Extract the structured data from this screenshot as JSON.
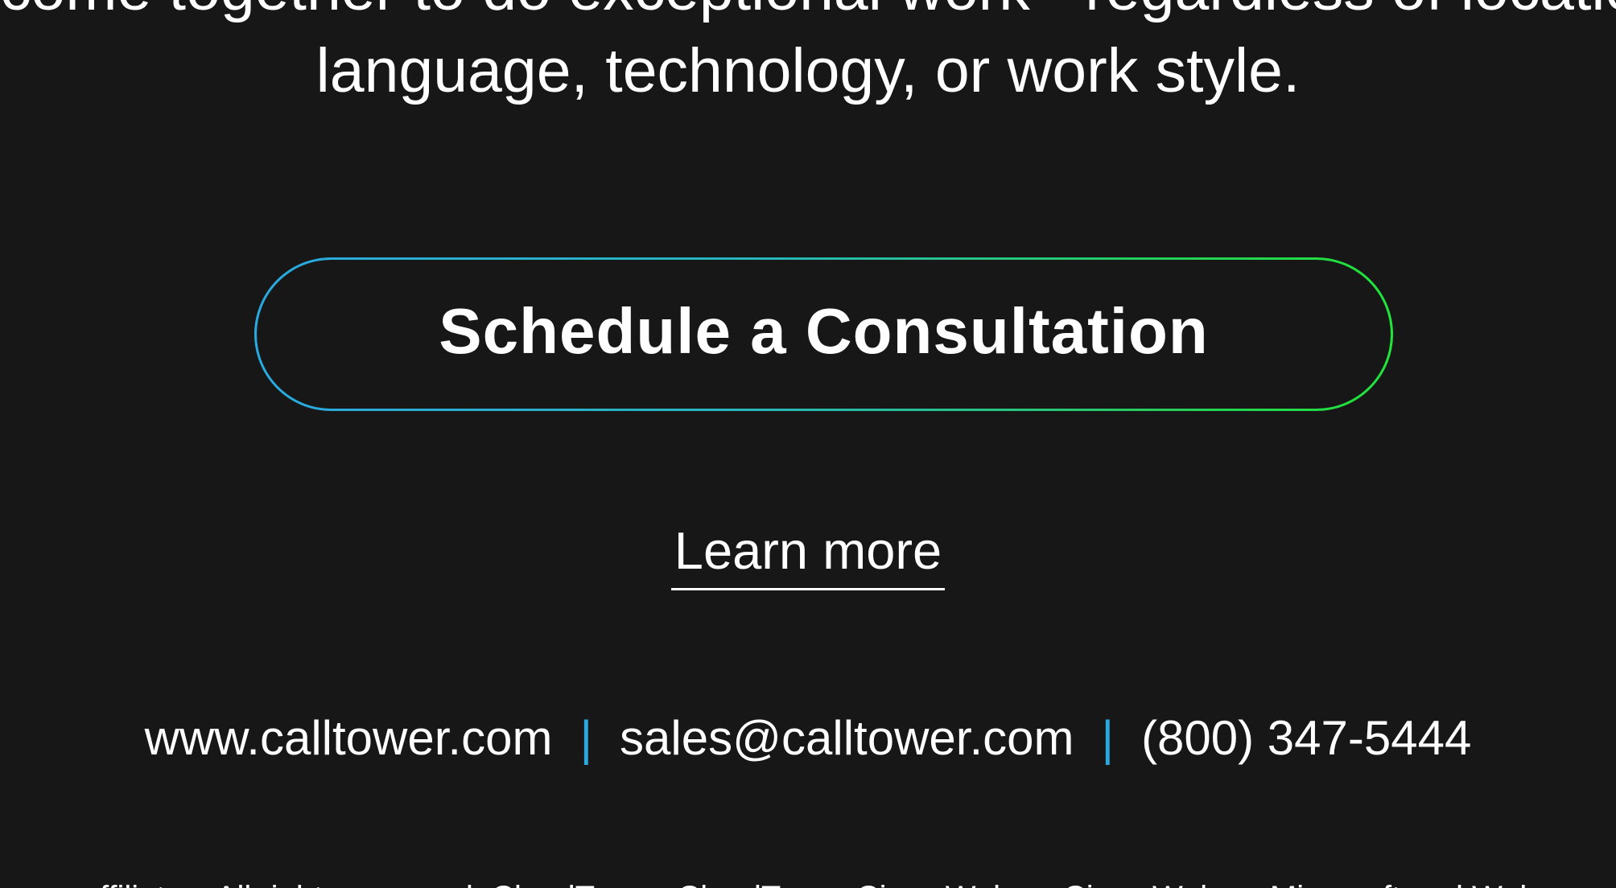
{
  "hero": {
    "line_1": "come together to do exceptional work - regardless of location,",
    "line_2": "language, technology, or work style."
  },
  "cta": {
    "label": "Schedule a Consultation"
  },
  "learn_more": {
    "label": "Learn more"
  },
  "contact": {
    "website": "www.calltower.com",
    "separator": "|",
    "email": "sales@calltower.com",
    "phone": "(800) 347-5444"
  },
  "footer": {
    "text": "or affiliates. All rights reserved. CloudTower, CloudTower Cisco Webex, Cisco Webex, Microsoft and Webex"
  },
  "colors": {
    "background": "#171717",
    "gradient_start": "#2aa9e0",
    "gradient_end": "#21e43a",
    "separator": "#2aa9e0"
  }
}
